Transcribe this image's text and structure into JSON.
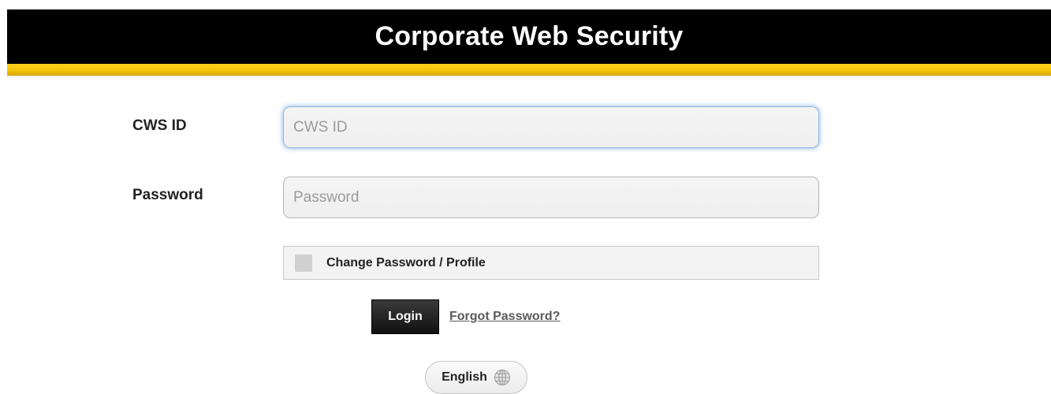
{
  "header": {
    "title": "Corporate Web Security"
  },
  "form": {
    "cws_id": {
      "label": "CWS ID",
      "placeholder": "CWS ID",
      "value": ""
    },
    "password": {
      "label": "Password",
      "placeholder": "Password",
      "value": ""
    },
    "change_password": {
      "label": "Change Password / Profile",
      "checked": false
    },
    "login_label": "Login",
    "forgot_label": "Forgot Password?"
  },
  "language": {
    "label": "English",
    "icon": "globe-icon"
  },
  "colors": {
    "header_bg": "#000000",
    "accent_stripe": "#ffd11a",
    "focus_glow": "#5298e6"
  }
}
